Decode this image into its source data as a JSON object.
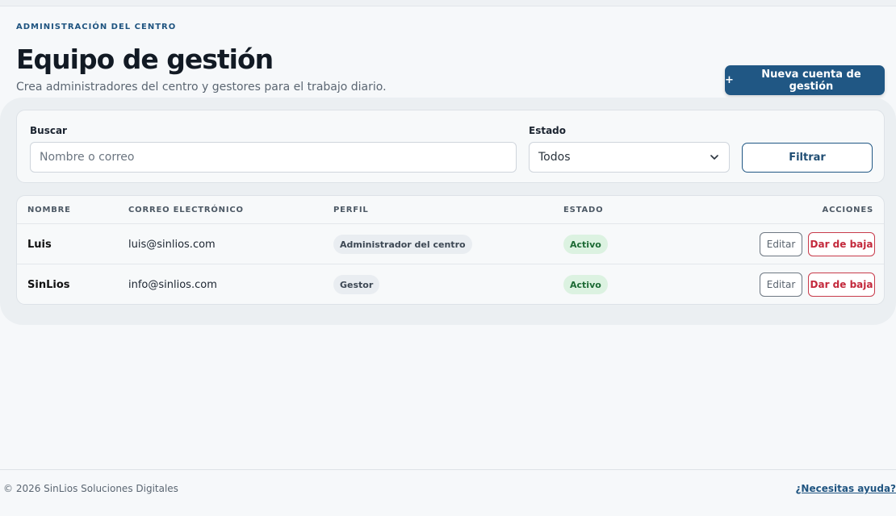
{
  "header": {
    "eyebrow": "ADMINISTRACIÓN DEL CENTRO",
    "title": "Equipo de gestión",
    "subtitle": "Crea administradores del centro y gestores para el trabajo diario.",
    "new_button_icon": "+",
    "new_button_label": "Nueva cuenta de gestión"
  },
  "filters": {
    "search_label": "Buscar",
    "search_placeholder": "Nombre o correo",
    "search_value": "",
    "status_label": "Estado",
    "status_selected": "Todos",
    "filter_button": "Filtrar"
  },
  "table": {
    "columns": {
      "name": "NOMBRE",
      "email": "CORREO ELECTRÓNICO",
      "profile": "PERFIL",
      "status": "ESTADO",
      "actions": "ACCIONES"
    },
    "rows": [
      {
        "name": "Luis",
        "email": "luis@sinlios.com",
        "profile": "Administrador del centro",
        "status": "Activo",
        "edit": "Editar",
        "delete": "Dar de baja"
      },
      {
        "name": "SinLios",
        "email": "info@sinlios.com",
        "profile": "Gestor",
        "status": "Activo",
        "edit": "Editar",
        "delete": "Dar de baja"
      }
    ]
  },
  "footer": {
    "copyright": "© 2026 SinLios Soluciones Digitales",
    "help_link": "¿Necesitas ayuda?"
  },
  "colors": {
    "primary": "#205784",
    "danger": "#c3283b",
    "success_bg": "#dcf2e1"
  }
}
